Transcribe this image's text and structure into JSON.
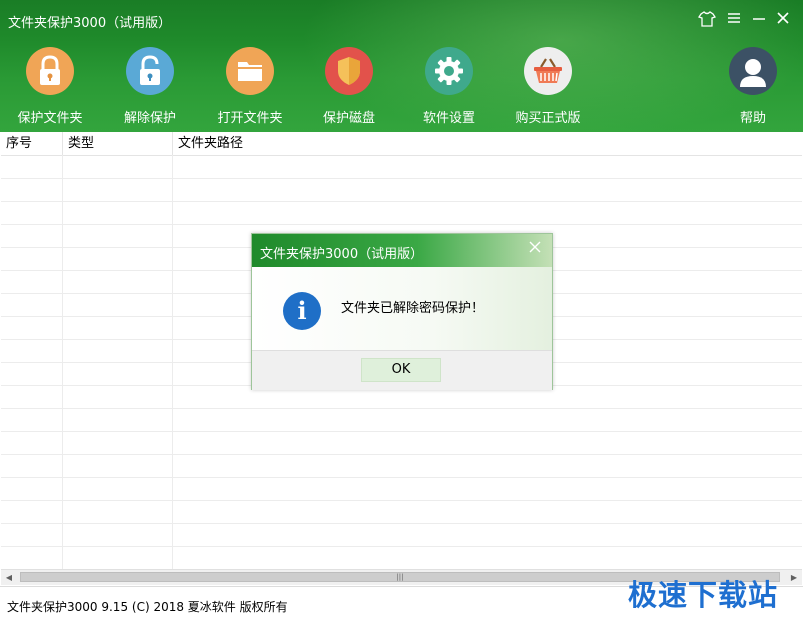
{
  "window": {
    "title": "文件夹保护3000（试用版）"
  },
  "toolbar": {
    "protect_folder": "保护文件夹",
    "unprotect": "解除保护",
    "open_folder": "打开文件夹",
    "protect_disk": "保护磁盘",
    "settings": "软件设置",
    "buy": "购买正式版",
    "help": "帮助"
  },
  "table": {
    "columns": [
      "序号",
      "类型",
      "文件夹路径"
    ],
    "rows": []
  },
  "dialog": {
    "title": "文件夹保护3000（试用版）",
    "message": "文件夹已解除密码保护！",
    "ok_label": "OK",
    "icon": "info-icon"
  },
  "scrollbar": {
    "thumb_grip": "|||"
  },
  "status": {
    "text": "文件夹保护3000 9.15 (C) 2018 夏冰软件 版权所有",
    "watermark": "极速下载站"
  },
  "colors": {
    "header_green": "#1f8a2b",
    "accent_blue": "#1f6fc7",
    "watermark_blue": "#1e6fd0"
  }
}
